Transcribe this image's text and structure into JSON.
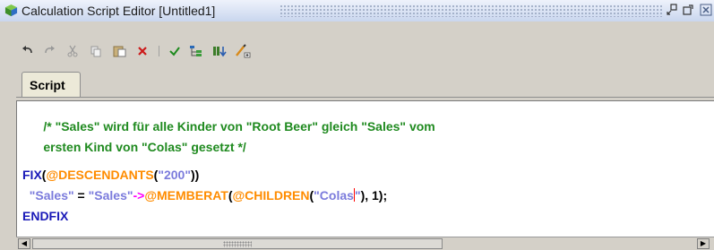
{
  "window": {
    "title": "Calculation Script Editor [Untitled1]"
  },
  "toolbar": {
    "buttons": [
      "undo",
      "redo",
      "cut",
      "copy",
      "paste",
      "delete",
      "validate",
      "outline",
      "insert-members",
      "insert-function"
    ]
  },
  "tabs": [
    {
      "label": "Script",
      "active": true
    }
  ],
  "editor": {
    "line1": {
      "part1": "/* \"Sales\" wird für alle Kinder von \"Root Beer\" gleich \"Sales\" vom"
    },
    "line2": {
      "part1": "ersten Kind von \"Colas\" gesetzt */"
    },
    "line4": {
      "kw": "FIX",
      "p1": "(",
      "fn": "@DESCENDANTS",
      "p2": "(",
      "str": "\"200\"",
      "p3": "))"
    },
    "line5": {
      "indent": "  ",
      "s1": "\"Sales\"",
      "eq": " = ",
      "s2": "\"Sales\"",
      "arrow": "->",
      "fn1": "@MEMBERAT",
      "p1": "(",
      "fn2": "@CHILDREN",
      "p2": "(",
      "s3": "\"Colas",
      "s4": "\"",
      "p3": "), 1);"
    },
    "line6": {
      "kw": "ENDFIX"
    }
  },
  "colors": {
    "comment": "#1f8a1f",
    "keyword": "#1a1ab8",
    "function": "#ff8c00",
    "string": "#7b7bdc",
    "arrow": "#ff00ff",
    "caret": "#ff0000"
  }
}
